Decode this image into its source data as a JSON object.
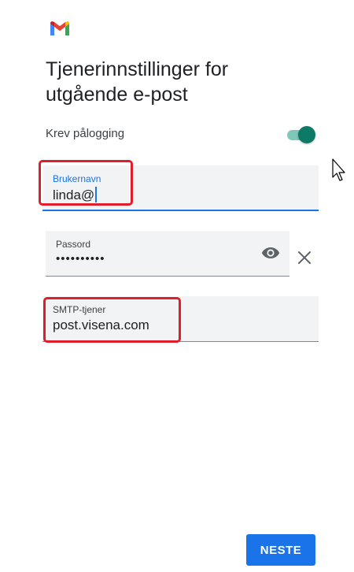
{
  "app": {
    "logo_icon": "gmail-logo-icon"
  },
  "page": {
    "title_line1": "Tjenerinnstillinger for",
    "title_line2": "utgående e-post"
  },
  "require_login": {
    "label": "Krev pålogging",
    "enabled": true,
    "accent": "#0d7a68"
  },
  "username": {
    "label": "Brukernavn",
    "value": "linda@"
  },
  "password": {
    "label": "Passord",
    "value": "••••••••••",
    "visibility_icon": "eye-icon",
    "clear_icon": "close-icon"
  },
  "smtp": {
    "label": "SMTP-tjener",
    "value": "post.visena.com"
  },
  "actions": {
    "next_label": "NESTE"
  },
  "colors": {
    "primary": "#1a73e8",
    "highlight": "#e01e2b"
  }
}
